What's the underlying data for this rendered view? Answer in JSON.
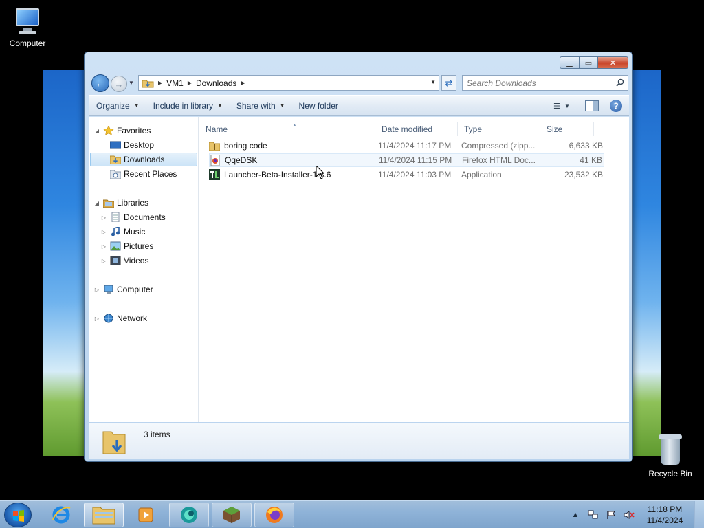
{
  "desktop": {
    "computer_label": "Computer",
    "recycle_label": "Recycle Bin"
  },
  "window": {
    "min_glyph": "▁",
    "max_glyph": "▭",
    "close_glyph": "✕"
  },
  "address": {
    "crumbs": [
      "VM1",
      "Downloads"
    ],
    "search_placeholder": "Search Downloads"
  },
  "toolbar": {
    "organize": "Organize",
    "include_library": "Include in library",
    "share_with": "Share with",
    "new_folder": "New folder",
    "help_glyph": "?"
  },
  "nav": {
    "favorites": "Favorites",
    "desktop": "Desktop",
    "downloads": "Downloads",
    "recent_places": "Recent Places",
    "libraries": "Libraries",
    "documents": "Documents",
    "music": "Music",
    "pictures": "Pictures",
    "videos": "Videos",
    "computer": "Computer",
    "network": "Network"
  },
  "columns": {
    "name": "Name",
    "date": "Date modified",
    "type": "Type",
    "size": "Size"
  },
  "files": [
    {
      "name": "boring code",
      "date": "11/4/2024 11:17 PM",
      "type": "Compressed (zipp...",
      "size": "6,633 KB"
    },
    {
      "name": "QqeDSK",
      "date": "11/4/2024 11:15 PM",
      "type": "Firefox HTML Doc...",
      "size": "41 KB"
    },
    {
      "name": "Launcher-Beta-Installer-1.3.6",
      "date": "11/4/2024 11:03 PM",
      "type": "Application",
      "size": "23,532 KB"
    }
  ],
  "details": {
    "count": "3 items"
  },
  "taskbar": {
    "time": "11:18 PM",
    "date": "11/4/2024"
  },
  "colors": {
    "selection": "#cce4f7",
    "close_button": "#c8452a",
    "taskbar": "#8fb3d8"
  }
}
